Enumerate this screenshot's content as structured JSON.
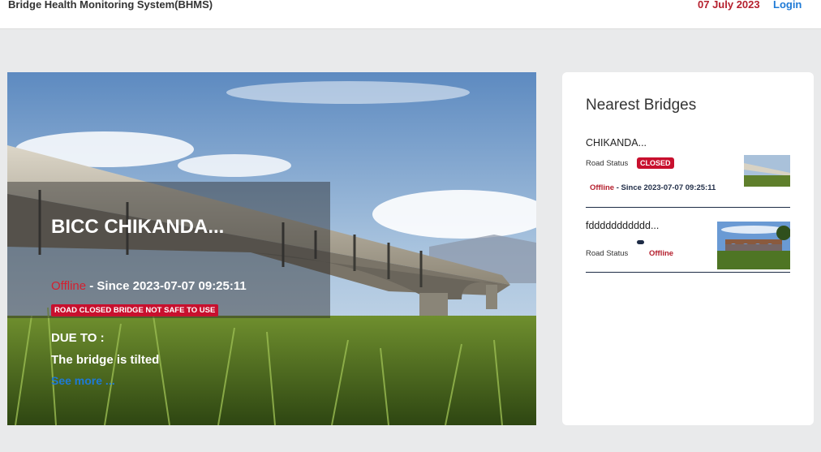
{
  "header": {
    "app_title": "Bridge Health Monitoring System(BHMS)",
    "date": "07 July 2023",
    "login_label": "Login"
  },
  "hero": {
    "bridge_name": "BICC CHIKANDA...",
    "status": "Offline",
    "since_text": " - Since 2023-07-07 09:25:11",
    "closed_banner": "ROAD CLOSED BRIDGE NOT SAFE TO USE",
    "due_label": "DUE TO :",
    "due_reason": "The bridge is tilted",
    "see_more": "See more ..."
  },
  "nearest": {
    "title": "Nearest Bridges",
    "items": [
      {
        "name": "CHIKANDA...",
        "road_status_label": "Road Status",
        "badge": "CLOSED",
        "status": "Offline",
        "since_text": " - Since 2023-07-07 09:25:11"
      },
      {
        "name": "fddddddddddd...",
        "road_status_label": "Road Status",
        "status": "Offline"
      }
    ]
  },
  "colors": {
    "accent_red": "#c8102e",
    "link_blue": "#1e7ad6",
    "navy": "#1d2b45"
  }
}
